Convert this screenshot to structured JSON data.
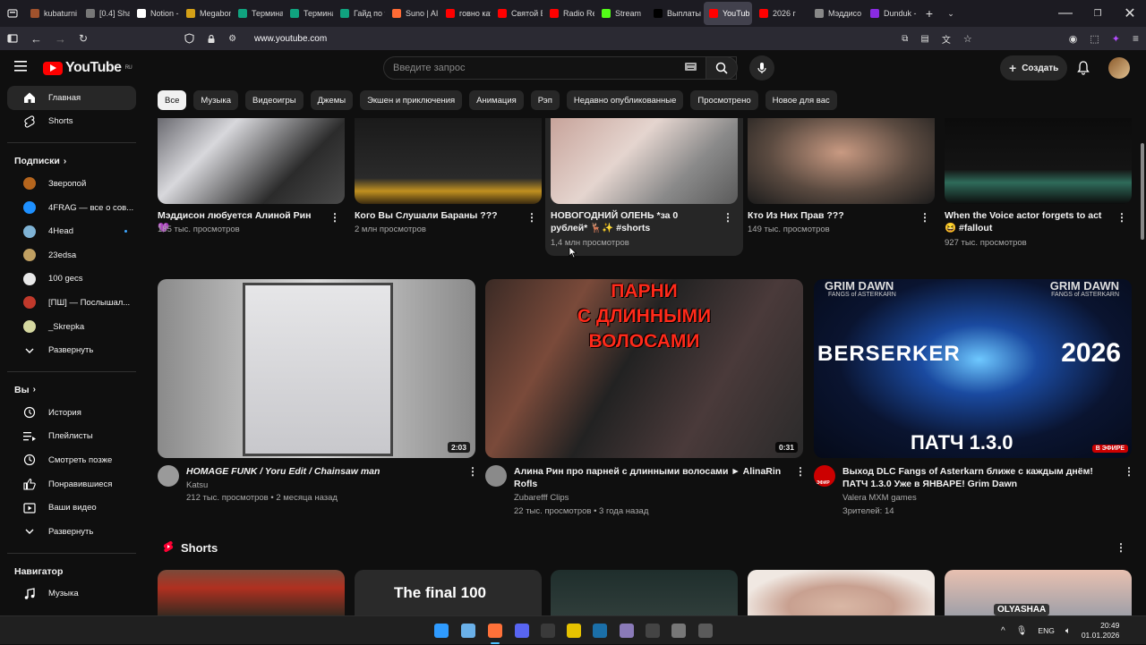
{
  "browser": {
    "tabs": [
      {
        "label": "kubaturni",
        "color": "#a0522d"
      },
      {
        "label": "[0.4] Shar",
        "color": "#777777"
      },
      {
        "label": "Notion -",
        "color": "#ffffff"
      },
      {
        "label": "Megabon",
        "color": "#d4a017"
      },
      {
        "label": "Термина",
        "color": "#10a37f"
      },
      {
        "label": "Термина",
        "color": "#10a37f"
      },
      {
        "label": "Гайд по т",
        "color": "#10a37f"
      },
      {
        "label": "Suno | AI",
        "color": "#ff6b35"
      },
      {
        "label": "говно кат",
        "color": "#ff0000"
      },
      {
        "label": "Святой Б",
        "color": "#ff0000"
      },
      {
        "label": "Radio Re",
        "color": "#ff0000"
      },
      {
        "label": "Stream",
        "color": "#53fc18"
      },
      {
        "label": "Выплаты",
        "color": "#000000"
      },
      {
        "label": "YouTub",
        "color": "#ff0000"
      },
      {
        "label": "2026 г",
        "color": "#ff0000"
      },
      {
        "label": "Мэддисо",
        "color": "#888888"
      },
      {
        "label": "Dunduk -",
        "color": "#8a2be2"
      }
    ],
    "active_tab": 13,
    "url": "www.youtube.com"
  },
  "header": {
    "logo_text": "YouTube",
    "logo_region": "RU",
    "search_placeholder": "Введите запрос",
    "create_label": "Создать"
  },
  "sidebar": {
    "main": [
      {
        "label": "Главная",
        "icon": "home-icon"
      },
      {
        "label": "Shorts",
        "icon": "shorts-icon"
      }
    ],
    "subs_title": "Подписки",
    "subs": [
      {
        "label": "Зверопой",
        "color": "#b5651d"
      },
      {
        "label": "4FRAG — все о сов...",
        "color": "#1e90ff"
      },
      {
        "label": "4Head",
        "color": "#7fb3d5"
      },
      {
        "label": "23edsa",
        "color": "#c0a062"
      },
      {
        "label": "100 gecs",
        "color": "#e8e8e8"
      },
      {
        "label": "[ПШ] — Послышал...",
        "color": "#c0392b"
      },
      {
        "label": "_Skrepka",
        "color": "#d5d8a0"
      }
    ],
    "expand_label": "Развернуть",
    "you_title": "Вы",
    "you": [
      {
        "label": "История",
        "icon": "history-icon"
      },
      {
        "label": "Плейлисты",
        "icon": "playlists-icon"
      },
      {
        "label": "Смотреть позже",
        "icon": "watch-later-icon"
      },
      {
        "label": "Понравившиеся",
        "icon": "like-icon"
      },
      {
        "label": "Ваши видео",
        "icon": "your-videos-icon"
      }
    ],
    "expand_label2": "Развернуть",
    "nav_title": "Навигатор",
    "nav": [
      {
        "label": "Музыка",
        "icon": "music-icon"
      }
    ]
  },
  "chips": [
    "Все",
    "Музыка",
    "Видеоигры",
    "Джемы",
    "Экшен и приключения",
    "Анимация",
    "Рэп",
    "Недавно опубликованные",
    "Просмотрено",
    "Новое для вас"
  ],
  "shorts_row": [
    {
      "title": "Мэддисон любуется Алиной Рин 💜",
      "views": "185 тыс. просмотров"
    },
    {
      "title": "Кого Вы Слушали Бараны ???",
      "views": "2 млн просмотров"
    },
    {
      "title": "НОВОГОДНИЙ ОЛЕНЬ *за 0 рублей* 🦌✨ #shorts",
      "views": "1,4 млн просмотров"
    },
    {
      "title": "Кто Из Них Прав ???",
      "views": "149 тыс. просмотров"
    },
    {
      "title": "When the Voice actor forgets to act 😆 #fallout",
      "views": "927 тыс. просмотров"
    }
  ],
  "videos": [
    {
      "title": "HOMAGE FUNK / Yoru Edit / Chainsaw man",
      "channel": "Katsu",
      "meta": "212 тыс. просмотров • 2 месяца назад",
      "duration": "2:03"
    },
    {
      "title": "Алина Рин про парней с длинными волосами ► AlinaRin Rofls",
      "channel": "Zubarefff Clips",
      "meta": "22 тыс. просмотров • 3 года назад",
      "duration": "0:31",
      "thumb_text": [
        "ПАРНИ",
        "С ДЛИННЫМИ",
        "ВОЛОСАМИ"
      ]
    },
    {
      "title": "Выход DLC Fangs of Asterkarn ближе с каждым днём! ПАТЧ 1.3.0 Уже в ЯНВАРЕ! Grim Dawn",
      "channel": "Valera MXM games",
      "meta": "Зрителей: 14",
      "live_badge": "В ЭФИРЕ",
      "avatar_text": "ЭФИР",
      "thumb_text": {
        "brand": "GRIM DAWN",
        "sub": "FANGS of ASTERKARN",
        "left": "BERSERKER",
        "right": "2026",
        "patch": "ПАТЧ 1.3.0"
      }
    }
  ],
  "shorts_section": {
    "title": "Shorts",
    "thumb_caption": "The final 100",
    "thumb_caption2": "OLYASHAA"
  },
  "taskbar": {
    "lang": "ENG",
    "time": "20:49",
    "date": "01.01.2026"
  }
}
